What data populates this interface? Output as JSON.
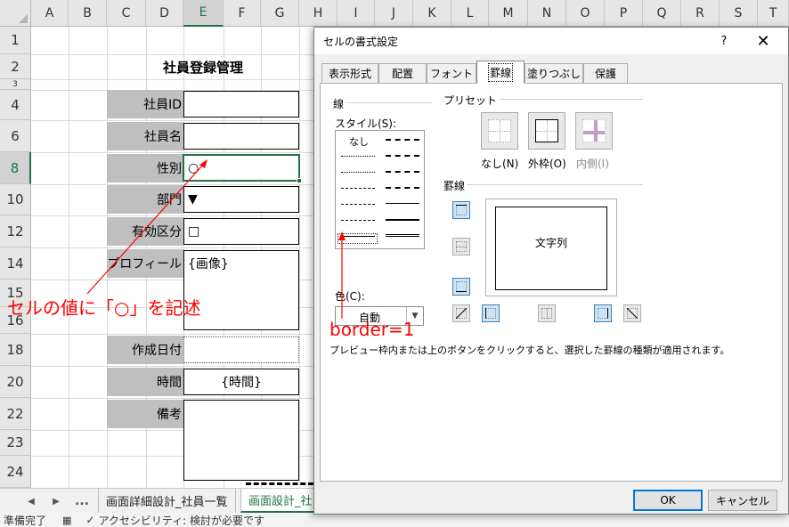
{
  "sheet": {
    "columns": [
      "A",
      "B",
      "C",
      "D",
      "E",
      "F",
      "G",
      "H",
      "I",
      "J",
      "K",
      "L",
      "M",
      "N",
      "O",
      "P",
      "Q",
      "R",
      "S",
      "T"
    ],
    "rows": [
      "1",
      "2",
      "3",
      "4",
      "6",
      "8",
      "10",
      "12",
      "14",
      "15",
      "16",
      "18",
      "20",
      "22",
      "23",
      "24"
    ],
    "title": "社員登録管理",
    "fields": [
      {
        "label": "社員ID",
        "value": ""
      },
      {
        "label": "社員名",
        "value": ""
      },
      {
        "label": "性別",
        "value": "○"
      },
      {
        "label": "部門",
        "value": "▼"
      },
      {
        "label": "有効区分",
        "value": "□"
      },
      {
        "label": "プロフィール",
        "value": "{画像}"
      },
      {
        "label": "作成日付",
        "value": ""
      },
      {
        "label": "時間",
        "value": "{時間}"
      },
      {
        "label": "備考",
        "value": ""
      }
    ]
  },
  "annotations": {
    "cell_note": "セルの値に「○」を記述",
    "border_note": "border=1",
    "color": "#ff0000"
  },
  "tabs": {
    "nav_prev": "◀",
    "nav_next": "▶",
    "more": "...",
    "items": [
      "画面詳細設計_社員一覧",
      "画面設計_社"
    ],
    "active_index": 1
  },
  "status": {
    "ready": "準備完了",
    "accessibility": "アクセシビリティ: 検討が必要です"
  },
  "dialog": {
    "title": "セルの書式設定",
    "help": "?",
    "close": "✕",
    "tabs": [
      "表示形式",
      "配置",
      "フォント",
      "罫線",
      "塗りつぶし",
      "保護"
    ],
    "active_tab": "罫線",
    "line_group": "線",
    "style_label": "スタイル(S):",
    "none_style": "なし",
    "color_label": "色(C):",
    "color_value": "自動",
    "preset_group": "プリセット",
    "presets": [
      "なし(N)",
      "外枠(O)",
      "内側(I)"
    ],
    "border_group": "罫線",
    "preview_text": "文字列",
    "hint": "プレビュー枠内または上のボタンをクリックすると、選択した罫線の種類が適用されます。",
    "ok": "OK",
    "cancel": "キャンセル"
  },
  "colors": {
    "excel_green": "#217346",
    "label_fill": "#bfbfbf",
    "accent_blue": "#0078d7"
  }
}
